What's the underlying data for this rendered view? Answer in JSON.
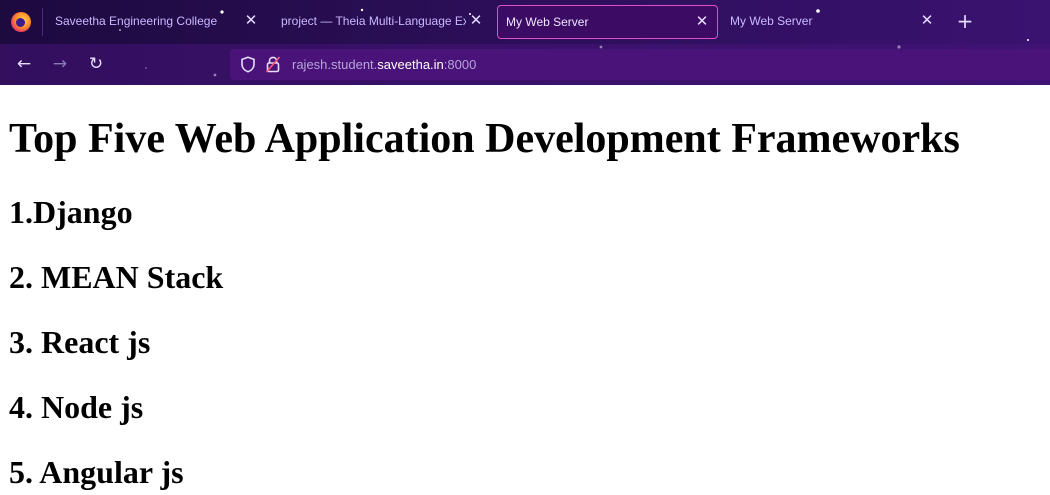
{
  "browser": {
    "tabs": [
      {
        "title": "Saveetha Engineering College",
        "close": "✕"
      },
      {
        "title": "project — Theia Multi-Language Ex",
        "close": "✕"
      },
      {
        "title": "My Web Server",
        "close": "✕"
      },
      {
        "title": "My Web Server",
        "close": "✕"
      }
    ],
    "active_tab": 2,
    "new_tab_label": "+",
    "nav": {
      "back": "←",
      "forward": "→",
      "reload": "↻"
    },
    "url": {
      "prefix": "rajesh.student.",
      "host": "saveetha.in",
      "suffix": ":8000"
    },
    "theme_colors": {
      "chrome": "#2a0e55",
      "active_tab_border": "#e04ec8",
      "urlbar": "#4a137a"
    }
  },
  "page": {
    "title": "Top Five Web Application Development Frameworks",
    "frameworks": [
      "1.Django",
      "2. MEAN Stack",
      "3. React js",
      "4. Node js",
      "5. Angular js"
    ]
  }
}
